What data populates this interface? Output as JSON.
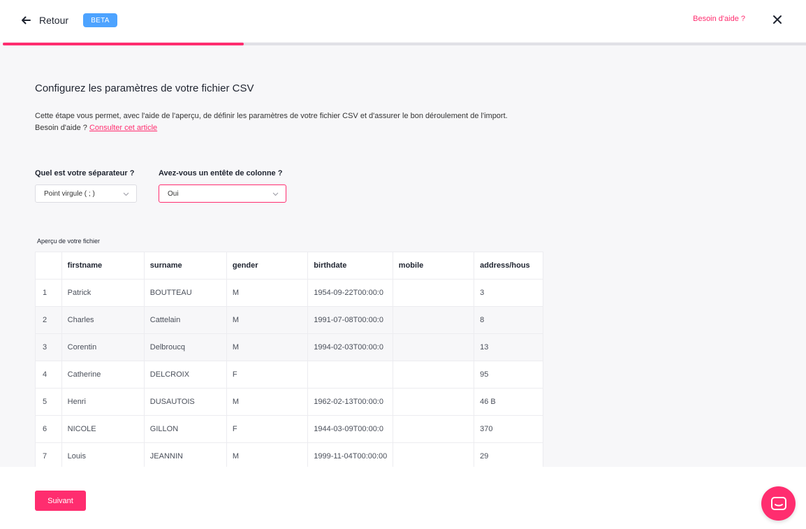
{
  "header": {
    "back_label": "Retour",
    "badge": "BETA",
    "help_label": "Besoin d'aide ?",
    "progress_fraction": 0.3
  },
  "main": {
    "title": "Configurez les paramètres de votre fichier CSV",
    "description_line1": "Cette étape vous permet, avec l'aide de l'aperçu, de définir les paramètres de votre fichier CSV et d'assurer le bon déroulement de l'import.",
    "description_line2_prefix": "Besoin d'aide ?",
    "description_link": "Consulter cet article"
  },
  "form": {
    "separator_label": "Quel est votre séparateur ?",
    "separator_value": "Point virgule ( ; )",
    "header_label": "Avez-vous un entête de colonne ?",
    "header_value": "Oui"
  },
  "preview": {
    "label": "Aperçu de votre fichier",
    "columns": [
      "",
      "firstname",
      "surname",
      "gender",
      "birthdate",
      "mobile",
      "address/hous"
    ],
    "rows": [
      [
        "1",
        "Patrick",
        "BOUTTEAU",
        "M",
        "1954-09-22T00:00:0",
        "",
        "3"
      ],
      [
        "2",
        "Charles",
        "Cattelain",
        "M",
        "1991-07-08T00:00:0",
        "",
        "8"
      ],
      [
        "3",
        "Corentin",
        "Delbroucq",
        "M",
        "1994-02-03T00:00:0",
        "",
        "13"
      ],
      [
        "4",
        "Catherine",
        "DELCROIX",
        "F",
        "",
        "",
        "95"
      ],
      [
        "5",
        "Henri",
        "DUSAUTOIS",
        "M",
        "1962-02-13T00:00:0",
        "",
        "46 B"
      ],
      [
        "6",
        "NICOLE",
        "GILLON",
        "F",
        "1944-03-09T00:00:0",
        "",
        "370"
      ],
      [
        "7",
        "Louis",
        "JEANNIN",
        "M",
        "1999-11-04T00:00:00",
        "",
        "29"
      ]
    ]
  },
  "footer": {
    "next_label": "Suivant"
  },
  "colors": {
    "accent": "#ff2d6f",
    "badge": "#4da3ff"
  },
  "icons": [
    "arrow-left-icon",
    "close-icon",
    "chevron-down-icon",
    "chat-icon"
  ]
}
